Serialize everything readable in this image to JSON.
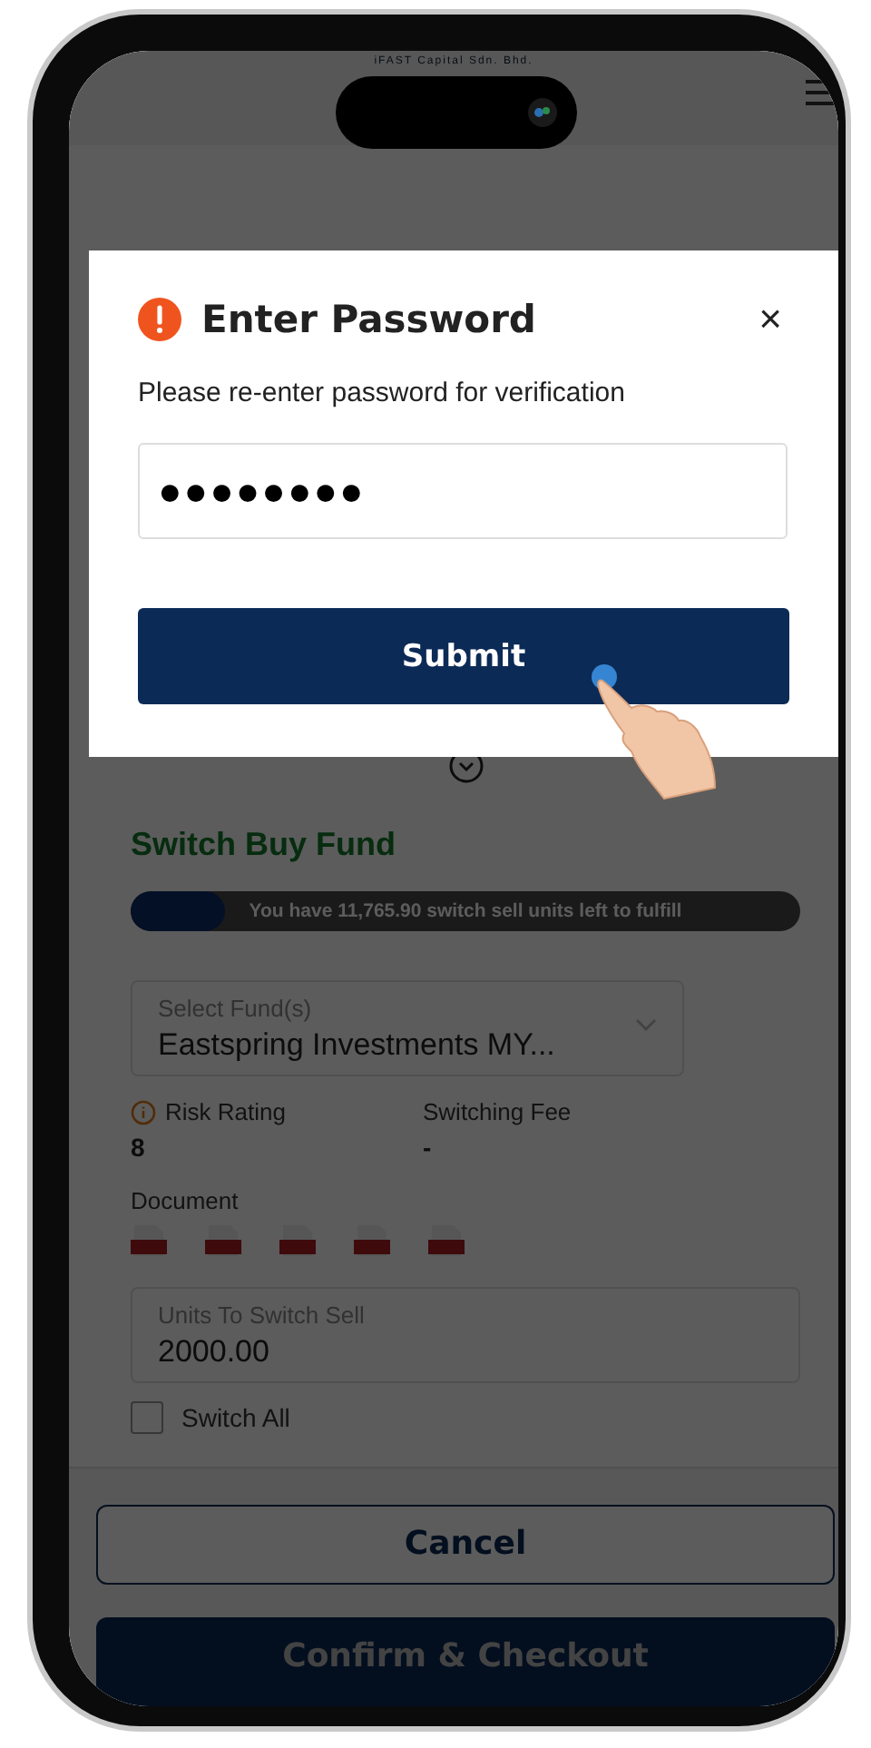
{
  "header": {
    "company": "iFAST Capital Sdn. Bhd."
  },
  "dialog": {
    "title": "Enter Password",
    "close": "×",
    "message": "Please re-enter password for verification",
    "password": {
      "value": "●●●●●●●●"
    },
    "submit": "Submit"
  },
  "switch_buy": {
    "title": "Switch Buy Fund",
    "progress": {
      "level": 0.14,
      "text": "You have 11,765.90 switch sell units left to fulfill"
    },
    "fund_select": {
      "label": "Select Fund(s)",
      "value": "Eastspring Investments MY..."
    },
    "risk_rating": {
      "label": "Risk Rating",
      "value": "8"
    },
    "switching_fee": {
      "label": "Switching Fee",
      "value": "-"
    },
    "document": {
      "label": "Document"
    },
    "units": {
      "label": "Units To Switch Sell",
      "value": "2000.00"
    },
    "switch_all": {
      "label": "Switch All",
      "checked": false
    }
  },
  "footer": {
    "cancel": "Cancel",
    "confirm": "Confirm & Checkout"
  }
}
